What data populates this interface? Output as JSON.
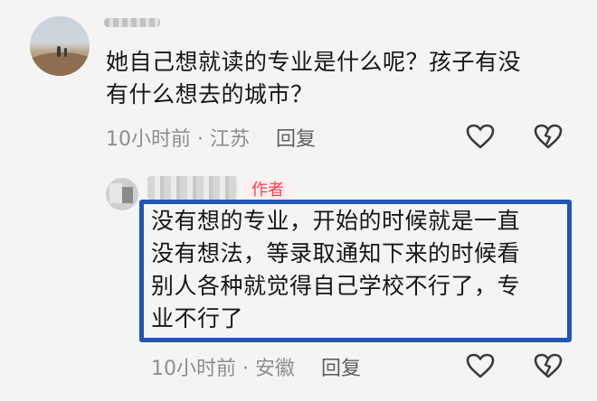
{
  "comments": [
    {
      "text_line1": "她自己想就读的专业是什么呢？孩子有没",
      "text_line2": "有什么想去的城市？",
      "time": "10小时前",
      "location": "江苏",
      "reply_label": "回复"
    },
    {
      "badge": "作者",
      "text_line1": "没有想的专业，开始的时候就是一直",
      "text_line2": "没有想法，等录取通知下来的时候看",
      "text_line3": "别人各种就觉得自己学校不行了，专",
      "text_line4": "业不行了",
      "time": "10小时前",
      "location": "安徽",
      "reply_label": "回复"
    }
  ],
  "icons": {
    "like": "heart-outline-icon",
    "dislike": "broken-heart-icon"
  },
  "colors": {
    "highlight_border": "#1f56b7",
    "author_badge_text": "#ff3b50",
    "author_badge_bg": "#fff0f0",
    "meta_text": "#8d8d8d"
  }
}
